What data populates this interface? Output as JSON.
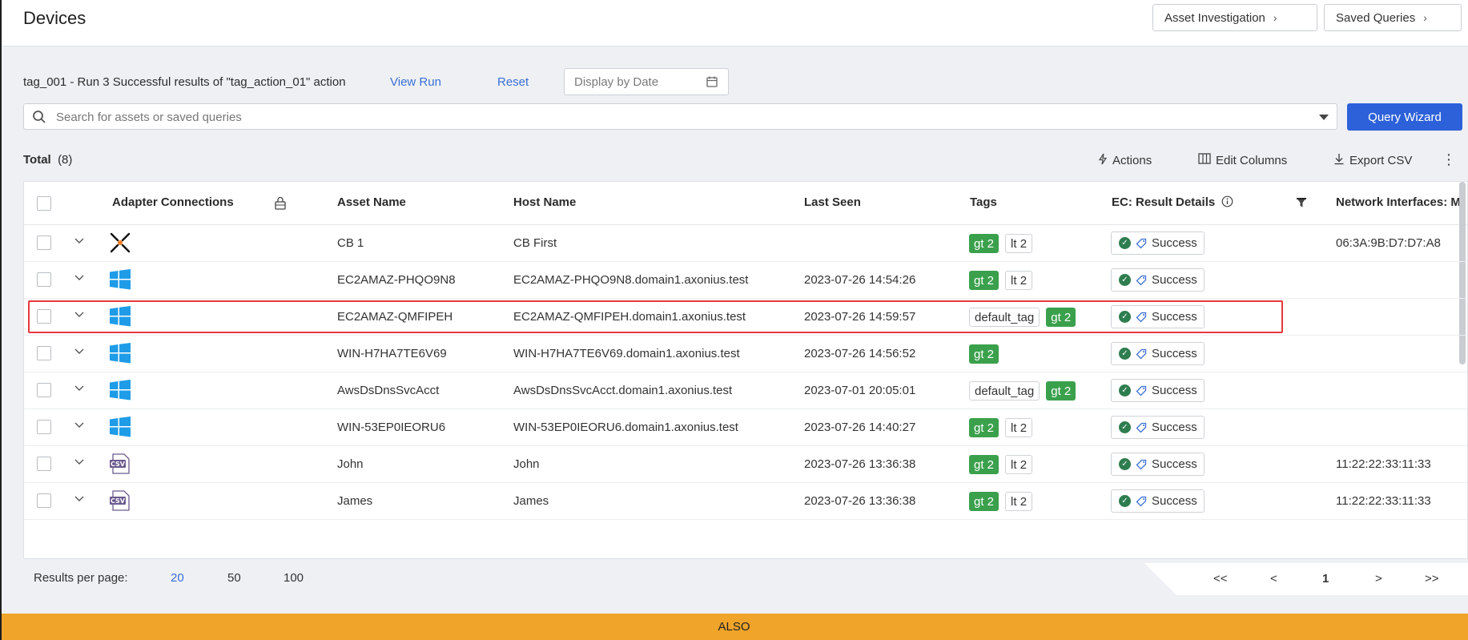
{
  "header": {
    "title": "Devices",
    "asset_investigation": "Asset Investigation",
    "saved_queries": "Saved Queries"
  },
  "run": {
    "description": "tag_001 - Run 3 Successful results of \"tag_action_01\" action",
    "view_run": "View Run",
    "reset": "Reset",
    "date_placeholder": "Display by Date"
  },
  "search": {
    "placeholder": "Search for assets or saved queries",
    "query_wizard": "Query Wizard"
  },
  "toolbar": {
    "total_label": "Total",
    "total_count": "(8)",
    "actions": "Actions",
    "edit_columns": "Edit Columns",
    "export_csv": "Export CSV"
  },
  "table": {
    "columns": {
      "adapter": "Adapter Connections",
      "asset_name": "Asset Name",
      "host_name": "Host Name",
      "last_seen": "Last Seen",
      "tags": "Tags",
      "result": "EC: Result Details",
      "network": "Network Interfaces: M"
    },
    "rows": [
      {
        "adapter": "carbonblack",
        "asset_name": "CB 1",
        "host_name": "CB First",
        "last_seen": "",
        "tags": [
          "gt 2",
          "lt 2"
        ],
        "result": "Success",
        "network": "06:3A:9B:D7:D7:A8"
      },
      {
        "adapter": "windows",
        "asset_name": "EC2AMAZ-PHQO9N8",
        "host_name": "EC2AMAZ-PHQO9N8.domain1.axonius.test",
        "last_seen": "2023-07-26 14:54:26",
        "tags": [
          "gt 2",
          "lt 2"
        ],
        "result": "Success",
        "network": ""
      },
      {
        "adapter": "windows",
        "asset_name": "EC2AMAZ-QMFIPEH",
        "host_name": "EC2AMAZ-QMFIPEH.domain1.axonius.test",
        "last_seen": "2023-07-26 14:59:57",
        "tags": [
          "default_tag",
          "gt 2"
        ],
        "result": "Success",
        "network": ""
      },
      {
        "adapter": "windows",
        "asset_name": "WIN-H7HA7TE6V69",
        "host_name": "WIN-H7HA7TE6V69.domain1.axonius.test",
        "last_seen": "2023-07-26 14:56:52",
        "tags": [
          "gt 2"
        ],
        "result": "Success",
        "network": ""
      },
      {
        "adapter": "windows",
        "asset_name": "AwsDsDnsSvcAcct",
        "host_name": "AwsDsDnsSvcAcct.domain1.axonius.test",
        "last_seen": "2023-07-01 20:05:01",
        "tags": [
          "default_tag",
          "gt 2"
        ],
        "result": "Success",
        "network": ""
      },
      {
        "adapter": "windows",
        "asset_name": "WIN-53EP0IEORU6",
        "host_name": "WIN-53EP0IEORU6.domain1.axonius.test",
        "last_seen": "2023-07-26 14:40:27",
        "tags": [
          "gt 2",
          "lt 2"
        ],
        "result": "Success",
        "network": ""
      },
      {
        "adapter": "csv",
        "asset_name": "John",
        "host_name": "John",
        "last_seen": "2023-07-26 13:36:38",
        "tags": [
          "gt 2",
          "lt 2"
        ],
        "result": "Success",
        "network": "11:22:22:33:11:33"
      },
      {
        "adapter": "csv",
        "asset_name": "James",
        "host_name": "James",
        "last_seen": "2023-07-26 13:36:38",
        "tags": [
          "gt 2",
          "lt 2"
        ],
        "result": "Success",
        "network": "11:22:22:33:11:33"
      }
    ]
  },
  "pagination": {
    "label": "Results per page:",
    "sizes": [
      "20",
      "50",
      "100"
    ],
    "active_size": "20",
    "first": "<<",
    "prev": "<",
    "current": "1",
    "next": ">",
    "last": ">>"
  },
  "footer": {
    "text": "ALSO"
  },
  "colors": {
    "accent": "#2d61d9",
    "tag_green": "#3aa04c",
    "highlight": "#e4393f",
    "footer": "#f0a42a"
  }
}
